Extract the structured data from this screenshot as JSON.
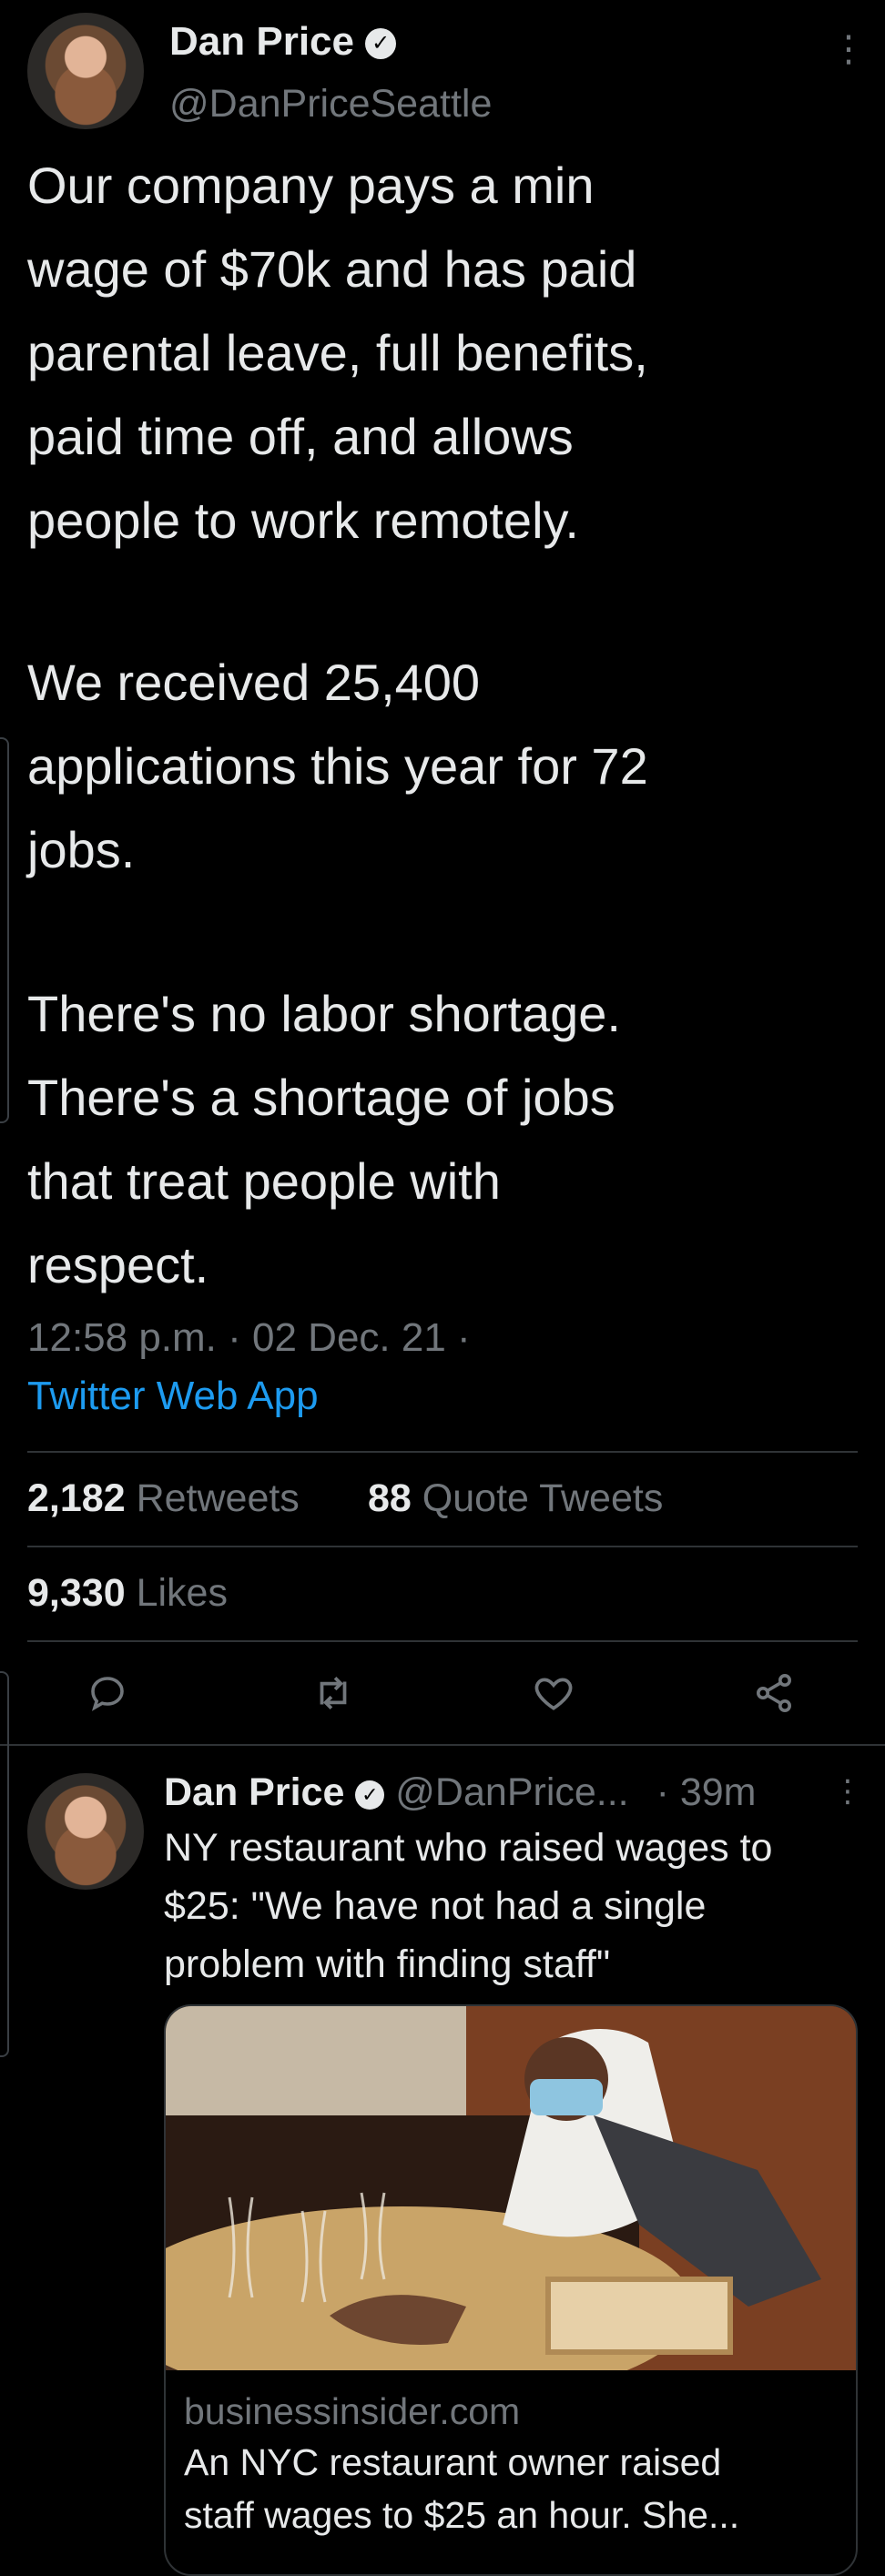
{
  "tweet": {
    "author_name": "Dan Price",
    "handle": "@DanPriceSeattle",
    "more_icon": "more-vertical-icon",
    "paragraphs": [
      "Our company pays a min\nwage of $70k and has paid\nparental leave, full benefits,\npaid time off, and allows\npeople to work remotely.",
      "We received 25,400\napplications this year for 72\njobs.",
      "There's no labor shortage.\nThere's a shortage of jobs\nthat treat people with\nrespect."
    ],
    "timestamp": "12:58 p.m. · 02 Dec. 21 ·",
    "source": "Twitter Web App",
    "retweets_count": "2,182",
    "retweets_label": "Retweets",
    "quote_count": "88",
    "quote_label": "Quote Tweets",
    "likes_count": "9,330",
    "likes_label": "Likes"
  },
  "actions": [
    {
      "name": "reply-icon"
    },
    {
      "name": "retweet-icon"
    },
    {
      "name": "like-icon"
    },
    {
      "name": "share-icon"
    }
  ],
  "reply": {
    "author_name": "Dan Price",
    "handle": "@DanPrice...",
    "time": "· 39m",
    "text": "NY restaurant who raised wages to\n$25: \"We have not had a single\nproblem with finding staff\"",
    "card_domain": "businessinsider.com",
    "card_title": "An NYC restaurant owner raised\nstaff wages to $25 an hour. She..."
  },
  "colors": {
    "background": "#000000",
    "text": "#e7e9ea",
    "muted": "#71767b",
    "link": "#1d9bf0",
    "divider": "#2f3336"
  }
}
